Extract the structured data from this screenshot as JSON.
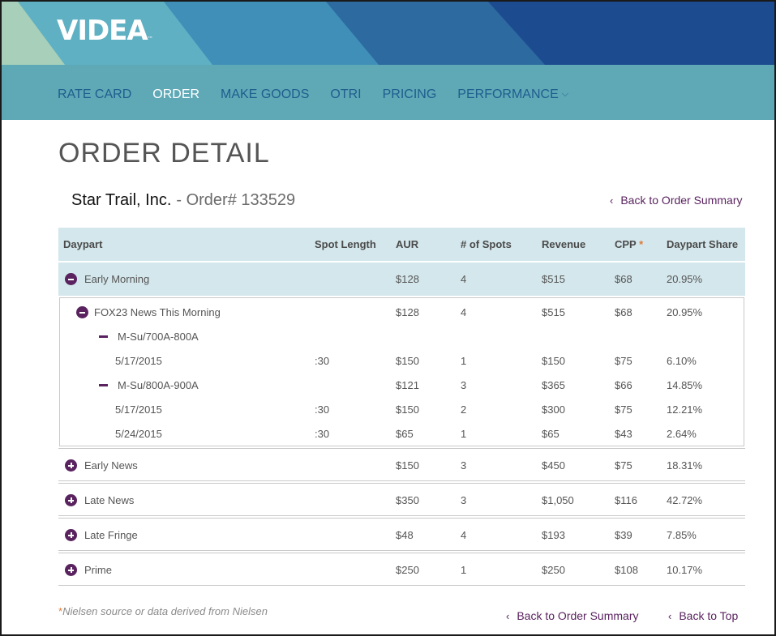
{
  "brand": {
    "logo_text": "VIDEA",
    "logo_mark": "™"
  },
  "colors": {
    "accent": "#5a2360",
    "nav_bg": "#5fa9b7",
    "header_bg": "#d4e7ec",
    "asterisk": "#e07b38"
  },
  "nav": {
    "items": [
      {
        "label": "RATE CARD"
      },
      {
        "label": "ORDER"
      },
      {
        "label": "MAKE GOODS"
      },
      {
        "label": "OTRI"
      },
      {
        "label": "PRICING"
      },
      {
        "label": "PERFORMANCE"
      }
    ],
    "active": "ORDER",
    "dropdown_icon": "chevron-down-icon"
  },
  "page": {
    "title": "ORDER DETAIL",
    "advertiser": "Star Trail, Inc.",
    "order_label": "- Order# 133529"
  },
  "links": {
    "back_summary": "Back to Order Summary",
    "back_top": "Back to Top"
  },
  "table": {
    "columns": [
      "Daypart",
      "Spot Length",
      "AUR",
      "# of Spots",
      "Revenue",
      "CPP",
      "Daypart Share"
    ],
    "cpp_asterisk": "*",
    "expanded": {
      "daypart": "Early Morning",
      "aur": "$128",
      "spots": "4",
      "revenue": "$515",
      "cpp": "$68",
      "share": "20.95%",
      "program": {
        "name": "FOX23 News This Morning",
        "aur": "$128",
        "spots": "4",
        "revenue": "$515",
        "cpp": "$68",
        "share": "20.95%"
      },
      "slots": [
        {
          "name": "M-Su/700A-800A",
          "aur": "",
          "spots": "",
          "revenue": "",
          "cpp": "",
          "share": "",
          "dates": [
            {
              "date": "5/17/2015",
              "length": ":30",
              "aur": "$150",
              "spots": "1",
              "revenue": "$150",
              "cpp": "$75",
              "share": "6.10%"
            }
          ]
        },
        {
          "name": "M-Su/800A-900A",
          "aur": "$121",
          "spots": "3",
          "revenue": "$365",
          "cpp": "$66",
          "share": "14.85%",
          "dates": [
            {
              "date": "5/17/2015",
              "length": ":30",
              "aur": "$150",
              "spots": "2",
              "revenue": "$300",
              "cpp": "$75",
              "share": "12.21%"
            },
            {
              "date": "5/24/2015",
              "length": ":30",
              "aur": "$65",
              "spots": "1",
              "revenue": "$65",
              "cpp": "$43",
              "share": "2.64%"
            }
          ]
        }
      ]
    },
    "collapsed": [
      {
        "daypart": "Early News",
        "aur": "$150",
        "spots": "3",
        "revenue": "$450",
        "cpp": "$75",
        "share": "18.31%"
      },
      {
        "daypart": "Late News",
        "aur": "$350",
        "spots": "3",
        "revenue": "$1,050",
        "cpp": "$116",
        "share": "42.72%"
      },
      {
        "daypart": "Late Fringe",
        "aur": "$48",
        "spots": "4",
        "revenue": "$193",
        "cpp": "$39",
        "share": "7.85%"
      },
      {
        "daypart": "Prime",
        "aur": "$250",
        "spots": "1",
        "revenue": "$250",
        "cpp": "$108",
        "share": "10.17%"
      }
    ]
  },
  "footnote": {
    "asterisk": "*",
    "text": "Nielsen source or data derived from Nielsen"
  }
}
